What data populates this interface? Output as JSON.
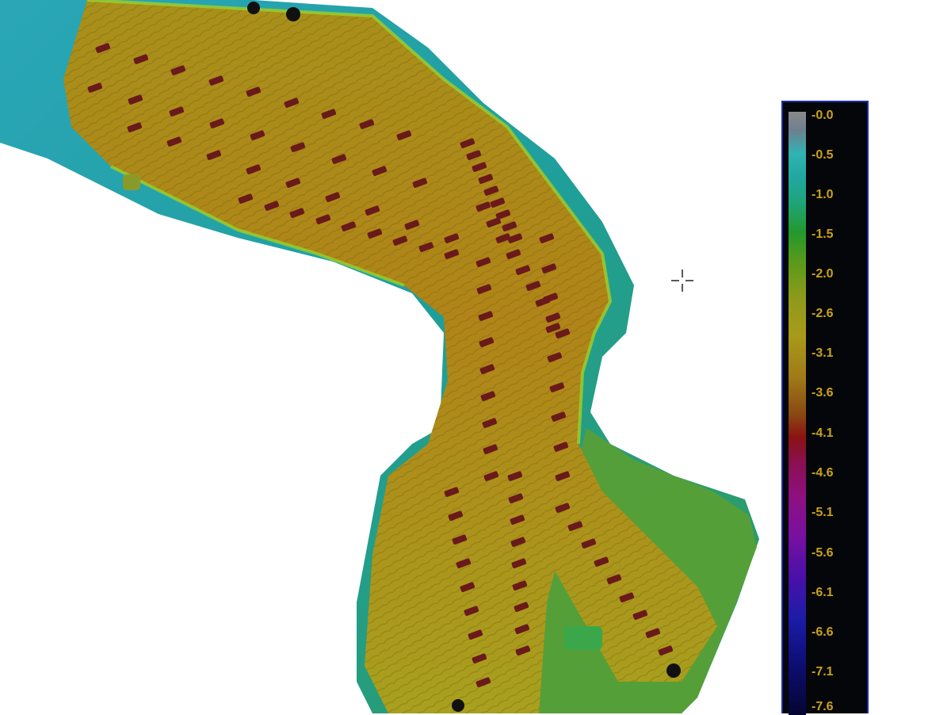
{
  "legend": {
    "labels": [
      "-0.0",
      "-0.5",
      "-1.0",
      "-1.5",
      "-2.0",
      "-2.6",
      "-3.1",
      "-3.6",
      "-4.1",
      "-4.6",
      "-5.1",
      "-5.6",
      "-6.1",
      "-6.6",
      "-7.1",
      "-7.6"
    ],
    "label_color": "#c8a21a",
    "border_color": "#1c2fa8"
  },
  "cursor": {
    "icon": "crosshair-icon"
  },
  "colors": {
    "shallow": "#1fa3a3",
    "mid": "#3a9a3a",
    "deep": "#a08a18",
    "trench": "#6a1a1a"
  }
}
